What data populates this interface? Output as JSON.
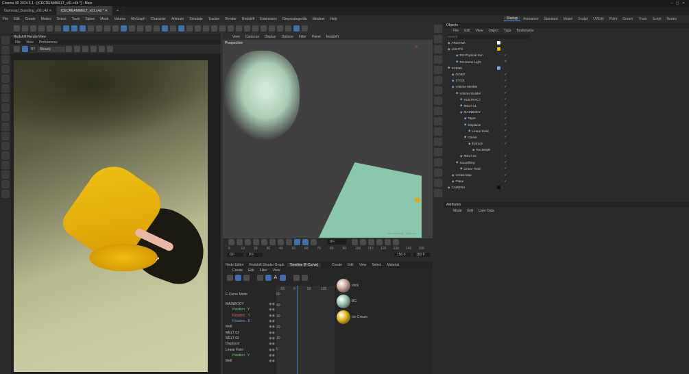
{
  "window": {
    "title": "Cinema 4D 2024.5.1 - [ICECREAMMELT_v01.c4d *] - Main"
  },
  "doc_tabs": [
    "Gumroad_Branding_v02.c4d",
    "ICECREAMMELT_v01.c4d *"
  ],
  "menus": [
    "File",
    "Edit",
    "Create",
    "Modes",
    "Select",
    "Tools",
    "Spline",
    "Mesh",
    "Volume",
    "MoGraph",
    "Character",
    "Animate",
    "Simulate",
    "Tracker",
    "Render",
    "Redshift",
    "Extensions",
    "Greyscalegorilla",
    "Window",
    "Help"
  ],
  "layouts": [
    "Startup",
    "Animation",
    "Standard",
    "Model",
    "Sculpt",
    "UVEdit",
    "Paint",
    "Groom",
    "Track",
    "Script",
    "Nodes"
  ],
  "active_layout": "Startup",
  "render_view": {
    "title": "Redshift RenderView",
    "menu": [
      "File",
      "View",
      "Preferences"
    ],
    "mode": "Beauty"
  },
  "viewport": {
    "menu": [
      "View",
      "Cameras",
      "Display",
      "Options",
      "Filter",
      "Panel",
      "Redshift"
    ],
    "label": "Perspective",
    "grid_spacing": "Grid Spacing : 1000 cm"
  },
  "timeline": {
    "current_frame": "0 F",
    "ticks": [
      "0",
      "10",
      "20",
      "30",
      "40",
      "50",
      "60",
      "70",
      "80",
      "90",
      "100",
      "110",
      "120",
      "130",
      "140",
      "150"
    ],
    "start": "0 F",
    "start2": "0 F",
    "end": "150 F",
    "end2": "150 F"
  },
  "bottom_left": {
    "tabs": [
      "Node Editor",
      "Redshift Shader Graph",
      "Timeline (F-Curve)"
    ],
    "menu": [
      "Create",
      "Edit",
      "Filter",
      "View"
    ],
    "mode": "F-Curve Mode",
    "xaxis": [
      "-50",
      "0",
      "50",
      "100"
    ],
    "yaxis": [
      "50",
      "40",
      "30",
      "20",
      "10",
      "0"
    ],
    "tracks": [
      {
        "name": "MAINBODY",
        "color": "#bbbbbb"
      },
      {
        "name": "Position . Y",
        "color": "#6fcf6f"
      },
      {
        "name": "Rotation . Y",
        "color": "#d86a6a"
      },
      {
        "name": "Rotation . B",
        "color": "#6a8ad8"
      },
      {
        "name": "Melt",
        "color": "#bbbbbb"
      },
      {
        "name": "MELT 01",
        "color": "#bbbbbb"
      },
      {
        "name": "MELT 02",
        "color": "#bbbbbb"
      },
      {
        "name": "Displacer",
        "color": "#bbbbbb"
      },
      {
        "name": "Linear Field",
        "color": "#bbbbbb"
      },
      {
        "name": "Position . Y",
        "color": "#6fcf6f"
      },
      {
        "name": "Melt",
        "color": "#bbbbbb"
      }
    ]
  },
  "materials": {
    "menu": [
      "Create",
      "Edit",
      "View",
      "Select",
      "Material"
    ],
    "items": [
      {
        "name": "stick",
        "color": "#c9a99a"
      },
      {
        "name": "BG",
        "color": "#9fc7b0"
      },
      {
        "name": "Ice Cream",
        "color": "#e2b81a"
      }
    ]
  },
  "objects": {
    "title": "Objects",
    "menu": [
      "File",
      "Edit",
      "View",
      "Object",
      "Tags",
      "Bookmarks"
    ],
    "search_placeholder": "Search",
    "rows": [
      {
        "name": "ARCHIVE",
        "indent": 0,
        "sel": false,
        "mark": "none",
        "color": "#ffffff"
      },
      {
        "name": "LIGHTS",
        "indent": 0,
        "sel": false,
        "mark": "none",
        "color": "#e6c200"
      },
      {
        "name": "RS Physical Sun",
        "indent": 2,
        "sel": false,
        "mark": "check",
        "color": ""
      },
      {
        "name": "RS Dome Light",
        "indent": 2,
        "sel": false,
        "mark": "x",
        "color": ""
      },
      {
        "name": "SCENE",
        "indent": 0,
        "sel": false,
        "mark": "none",
        "color": "#6fa8dc"
      },
      {
        "name": "GOBO",
        "indent": 1,
        "sel": false,
        "mark": "check",
        "color": ""
      },
      {
        "name": "STICK",
        "indent": 1,
        "sel": false,
        "mark": "check",
        "color": ""
      },
      {
        "name": "Volume Mesher",
        "indent": 1,
        "sel": false,
        "mark": "check",
        "color": ""
      },
      {
        "name": "Volume Builder",
        "indent": 2,
        "sel": false,
        "mark": "check",
        "color": ""
      },
      {
        "name": "SUBTRACT",
        "indent": 3,
        "sel": false,
        "mark": "check",
        "color": ""
      },
      {
        "name": "MELT 01",
        "indent": 3,
        "sel": false,
        "mark": "check",
        "color": ""
      },
      {
        "name": "MAINBODY",
        "indent": 3,
        "sel": false,
        "mark": "check",
        "color": ""
      },
      {
        "name": "Taper",
        "indent": 4,
        "sel": false,
        "mark": "check",
        "color": ""
      },
      {
        "name": "Displacer",
        "indent": 4,
        "sel": false,
        "mark": "check",
        "color": ""
      },
      {
        "name": "Linear Field",
        "indent": 5,
        "sel": false,
        "mark": "check",
        "color": ""
      },
      {
        "name": "Cloner",
        "indent": 4,
        "sel": false,
        "mark": "check",
        "color": ""
      },
      {
        "name": "Extrude",
        "indent": 5,
        "sel": false,
        "mark": "check",
        "color": ""
      },
      {
        "name": "Rectangle",
        "indent": 6,
        "sel": false,
        "mark": "none",
        "color": ""
      },
      {
        "name": "MELT 02",
        "indent": 3,
        "sel": false,
        "mark": "check",
        "color": ""
      },
      {
        "name": "Smoothing",
        "indent": 2,
        "sel": false,
        "mark": "check",
        "color": ""
      },
      {
        "name": "Linear Field",
        "indent": 3,
        "sel": false,
        "mark": "check",
        "color": ""
      },
      {
        "name": "Vertex Map",
        "indent": 1,
        "sel": false,
        "mark": "check",
        "color": ""
      },
      {
        "name": "Plane",
        "indent": 1,
        "sel": false,
        "mark": "check",
        "color": ""
      },
      {
        "name": "CAMERA",
        "indent": 0,
        "sel": false,
        "mark": "none",
        "color": "#111111"
      }
    ]
  },
  "attributes": {
    "title": "Attributes",
    "menu": [
      "Mode",
      "Edit",
      "User Data"
    ]
  }
}
